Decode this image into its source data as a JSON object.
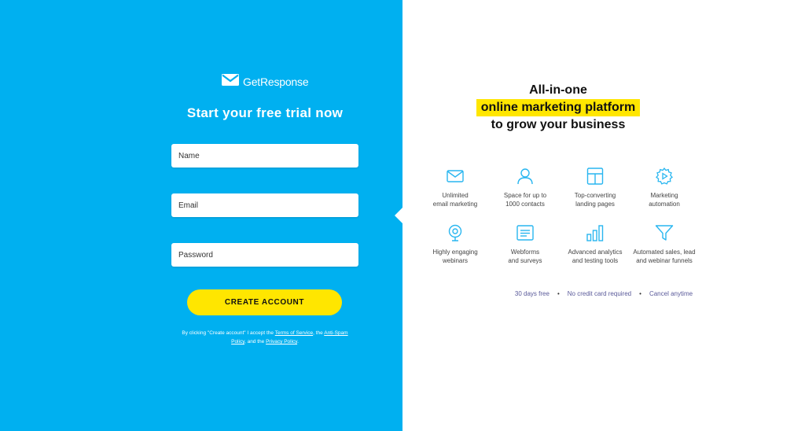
{
  "brand": {
    "name": "GetResponse",
    "icon": "envelope-logo-icon"
  },
  "form": {
    "headline": "Start your free trial now",
    "name_placeholder": "Name",
    "email_placeholder": "Email",
    "password_placeholder": "Password",
    "submit_label": "CREATE ACCOUNT",
    "legal": {
      "prefix": "By clicking \"Create account\" I accept the ",
      "terms": "Terms of Service",
      "sep1": ", the ",
      "antispam": "Anti-Spam Policy",
      "sep2": ", and the ",
      "privacy": "Privacy Policy",
      "suffix": "."
    }
  },
  "promo": {
    "title_line1": "All-in-one",
    "title_highlight": "online marketing platform",
    "title_line3": "to grow your business",
    "features": [
      {
        "icon": "envelope-icon",
        "line1": "Unlimited",
        "line2": "email marketing"
      },
      {
        "icon": "user-icon",
        "line1": "Space for up to",
        "line2": "1000 contacts"
      },
      {
        "icon": "layout-icon",
        "line1": "Top-converting",
        "line2": "landing pages"
      },
      {
        "icon": "gear-play-icon",
        "line1": "Marketing",
        "line2": "automation"
      },
      {
        "icon": "webcam-icon",
        "line1": "Highly engaging",
        "line2": "webinars"
      },
      {
        "icon": "form-icon",
        "line1": "Webforms",
        "line2": "and surveys"
      },
      {
        "icon": "bar-chart-icon",
        "line1": "Advanced analytics",
        "line2": "and testing tools"
      },
      {
        "icon": "funnel-icon",
        "line1": "Automated sales, lead",
        "line2": "and webinar funnels"
      }
    ],
    "footer": [
      "30 days free",
      "No credit card required",
      "Cancel anytime"
    ]
  },
  "colors": {
    "left_bg": "#00b0f0",
    "accent_yellow": "#ffe600",
    "icon_blue": "#29b6f0",
    "footer_text": "#5a5a9a"
  }
}
